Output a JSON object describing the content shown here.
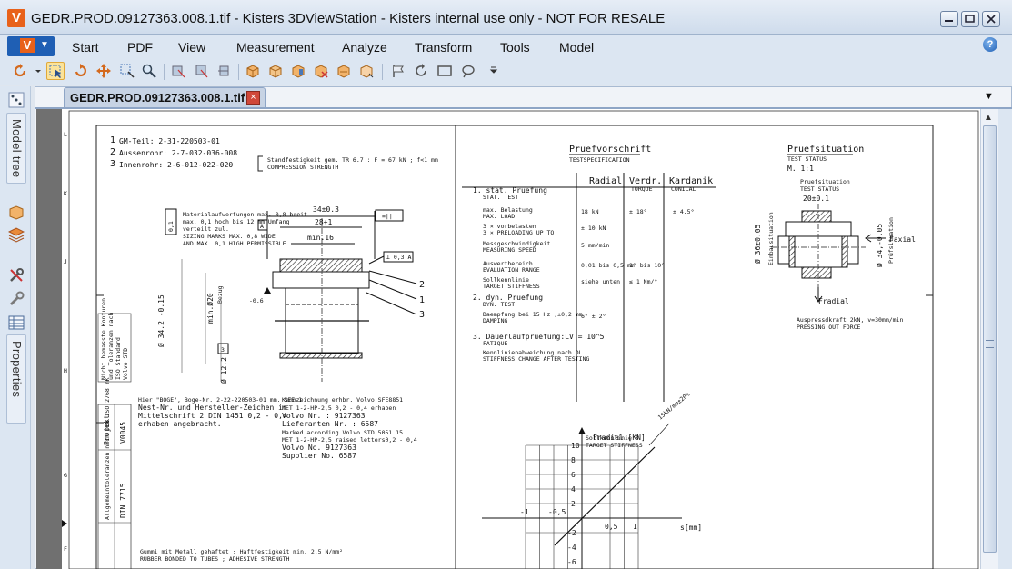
{
  "window": {
    "title": "GEDR.PROD.09127363.008.1.tif - Kisters 3DViewStation - Kisters internal use only - NOT FOR RESALE",
    "app_logo": "V"
  },
  "menu": {
    "app_button": "V",
    "items": [
      "Start",
      "PDF",
      "View",
      "Measurement",
      "Analyze",
      "Transform",
      "Tools",
      "Model"
    ],
    "help": "?"
  },
  "left_panel": {
    "tabs": [
      "Model tree",
      "Properties"
    ]
  },
  "document": {
    "tab_label": "GEDR.PROD.09127363.008.1.tif",
    "tab_close": "×"
  },
  "drawing": {
    "header_lines": [
      "GM-Teil: 2-31-220503-01",
      "Aussenrohr: 2-7-032-036-008",
      "Innenrohr: 2-6-012-022-020"
    ],
    "header_nums": [
      "1",
      "2",
      "3"
    ],
    "compression_note": "Standfestigkeit gem. TR 6.7 : F = 67 kN ; f<1 mm",
    "compression_strength": "COMPRESSION STRENGTH",
    "dims": {
      "d34": "34±0.3",
      "d28": "28+1",
      "dmin16": "min.16",
      "dmin20": "min.Ø20",
      "d34_2": "Ø 34.2 -0.15",
      "d12_2": "Ø 12.2",
      "d06": "-0.6"
    },
    "balloons": [
      "2",
      "1",
      "3"
    ],
    "pruefvorschrift": {
      "title": "Pruefvorschrift",
      "subtitle": "TESTSPECIFICATION",
      "col_radial": "Radial",
      "col_verdr": "Verdr.",
      "col_verdr_sub": "TORQUE",
      "col_kardanik": "Kardanik",
      "col_kardanik_sub": "CONICAL",
      "rows": [
        {
          "label": "1. stat. Pruefung",
          "sub": "STAT. TEST",
          "r": "",
          "v": "",
          "k": ""
        },
        {
          "label": "max. Belastung",
          "sub": "MAX. LOAD",
          "r": "18 kN",
          "v": "± 18°",
          "k": "± 4.5°"
        },
        {
          "label": "3 × vorbelasten",
          "sub": "3 × PRELOADING UP TO",
          "r": "± 10 kN",
          "v": "",
          "k": ""
        },
        {
          "label": "Messgeschwindigkeit",
          "sub": "MEASURING SPEED",
          "r": "5 mm/min",
          "v": "",
          "k": ""
        },
        {
          "label": "Auswertbereich",
          "sub": "EVALUATION RANGE",
          "r": "0,01 bis 0,5 mm",
          "v": "1° bis 10°",
          "k": ""
        },
        {
          "label": "Sollkennlinie",
          "sub": "TARGET STIFFNESS",
          "r": "siehe unten",
          "v": "≤ 1 Nm/°",
          "k": ""
        },
        {
          "label": "2. dyn. Pruefung",
          "sub": "DYN. TEST",
          "r": "",
          "v": "",
          "k": ""
        },
        {
          "label": "Daempfung bei 15 Hz ;±0,2 mm",
          "sub": "DAMPING",
          "r": "6° ± 2°",
          "v": "",
          "k": ""
        },
        {
          "label": "3. Dauerlaufpruefung:LV = 10^5",
          "sub": "FATIQUE",
          "r": "",
          "v": "",
          "k": ""
        },
        {
          "label": "Kennlinienabweichung nach DL",
          "sub": "STIFFNESS CHANGE AFTER TESTING",
          "r": "",
          "v": "",
          "k": ""
        }
      ]
    },
    "pruefsituation": {
      "title": "Pruefsituation",
      "subtitle": "TEST STATUS",
      "scale": "M. 1:1",
      "inner_title": "Pruefsituation",
      "inner_sub": "TEST STATUS",
      "dim_top": "20±0.1",
      "f_axial": "Faxial",
      "f_radial": "Fradial",
      "pressing": "Auspressdkraft 2kN, v=30mm/min",
      "pressing_sub": "PRESSING OUT FORCE"
    },
    "graph": {
      "ylabel": "Fradial [KN]",
      "xlabel": "s[mm]",
      "sollkennlinie": "Sollkennlinie 3",
      "target": "TARGET STIFFNESS",
      "y_ticks": [
        "10",
        "8",
        "6",
        "4",
        "2",
        "-2",
        "-4",
        "-6"
      ],
      "x_ticks": [
        "-1",
        "-0,5",
        "0,5",
        "1"
      ],
      "line_label": "15kN/mm±20%"
    },
    "notes": [
      "Hier \"BOGE\", Boge-Nr. 2-22-220503-01 mm. SEE-1",
      "Nest-Nr. und Hersteller-Zeichen in",
      "Mittelschrift 2 DIN 1451 0,2 - 0,4",
      "erhaben angebracht.",
      "Kennzeichnung erhbr. Volvo SFE8851",
      "MET 1-2-HP-2,5 0,2 - 0,4 erhaben",
      "Volvo Nr. : 9127363",
      "Lieferanten Nr. : 6587",
      "Marked according Volvo STD 5051.15",
      "MET 1-2-HP-2,5 raised letters0,2 - 0,4",
      "Volvo No. 9127363",
      "Supplier No. 6587",
      "Gummi mit Metall gehaftet ; Haftfestigkeit min. 2,5 N/mm²",
      "RUBBER BONDED TO TUBES ; ADHESIVE STRENGTH"
    ],
    "title_block": {
      "projekt": "Projekt",
      "projekt_no": "V0045",
      "allg": "Allgemeintoleranzen nach DIN ISO 2768 mK",
      "din": "ISO 2768 - mK",
      "din_no": "DIN 7715"
    }
  }
}
